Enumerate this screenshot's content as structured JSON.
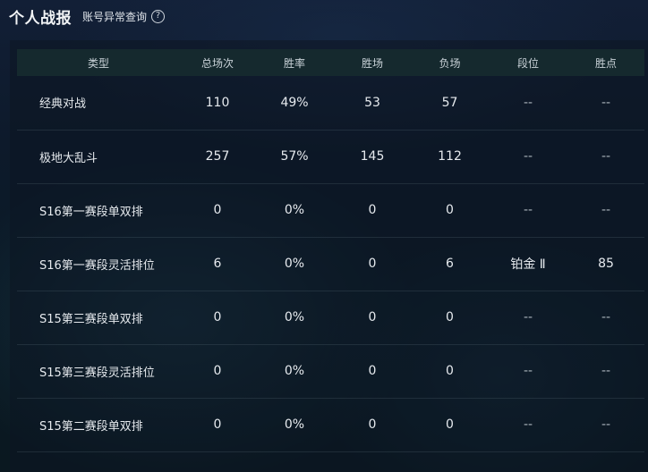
{
  "header": {
    "title": "个人战报",
    "link_label": "账号异常查询",
    "help_icon_glyph": "?"
  },
  "table": {
    "columns": [
      "类型",
      "总场次",
      "胜率",
      "胜场",
      "负场",
      "段位",
      "胜点"
    ],
    "rows": [
      {
        "type": "经典对战",
        "total": "110",
        "win_rate": "49%",
        "wins": "53",
        "losses": "57",
        "rank": "--",
        "points": "--"
      },
      {
        "type": "极地大乱斗",
        "total": "257",
        "win_rate": "57%",
        "wins": "145",
        "losses": "112",
        "rank": "--",
        "points": "--"
      },
      {
        "type": "S16第一赛段单双排",
        "total": "0",
        "win_rate": "0%",
        "wins": "0",
        "losses": "0",
        "rank": "--",
        "points": "--"
      },
      {
        "type": "S16第一赛段灵活排位",
        "total": "6",
        "win_rate": "0%",
        "wins": "0",
        "losses": "6",
        "rank": "铂金 Ⅱ",
        "points": "85"
      },
      {
        "type": "S15第三赛段单双排",
        "total": "0",
        "win_rate": "0%",
        "wins": "0",
        "losses": "0",
        "rank": "--",
        "points": "--"
      },
      {
        "type": "S15第三赛段灵活排位",
        "total": "0",
        "win_rate": "0%",
        "wins": "0",
        "losses": "0",
        "rank": "--",
        "points": "--"
      },
      {
        "type": "S15第二赛段单双排",
        "total": "0",
        "win_rate": "0%",
        "wins": "0",
        "losses": "0",
        "rank": "--",
        "points": "--"
      }
    ]
  }
}
